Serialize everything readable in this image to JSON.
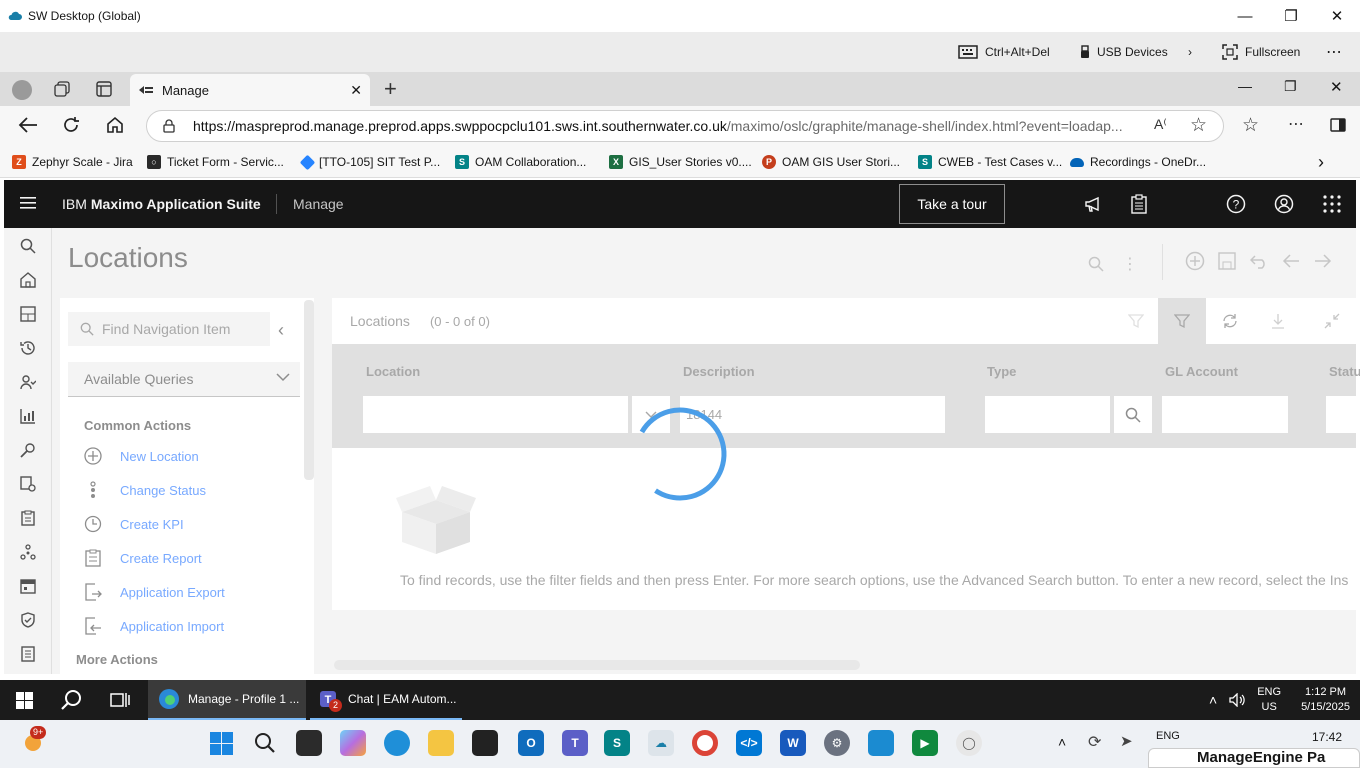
{
  "window": {
    "title": "SW Desktop (Global)"
  },
  "remote_toolbar": {
    "ctrl_alt_del": "Ctrl+Alt+Del",
    "usb": "USB Devices",
    "fullscreen": "Fullscreen"
  },
  "browser": {
    "tab_title": "Manage",
    "url_host": "https://maspreprod.manage.preprod.apps.swppocpclu101.sws.int.southernwater.co.uk",
    "url_path": "/maximo/oslc/graphite/manage-shell/index.html?event=loadap...",
    "bookmarks": [
      {
        "label": "Zephyr Scale - Jira",
        "color": "#e04e1b",
        "icon": "zephyr-icon"
      },
      {
        "label": "Ticket Form - Servic...",
        "color": "#2a2a2a",
        "icon": "servicenow-icon"
      },
      {
        "label": "[TTO-105] SIT Test P...",
        "color": "#2684ff",
        "icon": "jira-icon"
      },
      {
        "label": "OAM Collaboration...",
        "color": "#038387",
        "icon": "sharepoint-icon"
      },
      {
        "label": "GIS_User Stories v0....",
        "color": "#1d6f42",
        "icon": "excel-icon"
      },
      {
        "label": "OAM GIS User Stori...",
        "color": "#c43e1c",
        "icon": "powerpoint-icon"
      },
      {
        "label": "CWEB - Test Cases v...",
        "color": "#038387",
        "icon": "sharepoint-icon"
      },
      {
        "label": "Recordings - OneDr...",
        "color": "#0364b8",
        "icon": "onedrive-icon"
      }
    ]
  },
  "app": {
    "brand_prefix": "IBM",
    "brand_name": "Maximo Application Suite",
    "module": "Manage",
    "tour_button": "Take a tour",
    "page_title": "Locations",
    "nav_search_placeholder": "Find Navigation Item",
    "queries_label": "Available Queries",
    "common_actions_heading": "Common Actions",
    "actions": [
      {
        "label": "New Location",
        "icon": "add-circle-icon"
      },
      {
        "label": "Change Status",
        "icon": "status-dots-icon"
      },
      {
        "label": "Create KPI",
        "icon": "clock-icon"
      },
      {
        "label": "Create Report",
        "icon": "report-icon"
      },
      {
        "label": "Application Export",
        "icon": "export-icon"
      },
      {
        "label": "Application Import",
        "icon": "import-icon"
      }
    ],
    "more_actions_heading": "More Actions",
    "table": {
      "title": "Locations",
      "count": "(0 - 0 of 0)",
      "columns": [
        "Location",
        "Description",
        "Type",
        "GL Account",
        "Statu"
      ],
      "filter_description_value": "18144",
      "empty_message": "To find records, use the filter fields and then press Enter. For more search options, use the Advanced Search button. To enter a new record, select the Ins"
    }
  },
  "remote_taskbar": {
    "apps": [
      {
        "label": "Manage - Profile 1 ...",
        "icon": "edge-icon"
      },
      {
        "label": "Chat | EAM Autom...",
        "icon": "teams-icon",
        "badge": "2"
      }
    ],
    "lang": "ENG",
    "region": "US",
    "time": "1:12 PM",
    "date": "5/15/2025"
  },
  "local_taskbar": {
    "notif_badge": "9+",
    "lang": "ENG",
    "time": "17:42",
    "popup_text": "ManageEngine Pa"
  }
}
